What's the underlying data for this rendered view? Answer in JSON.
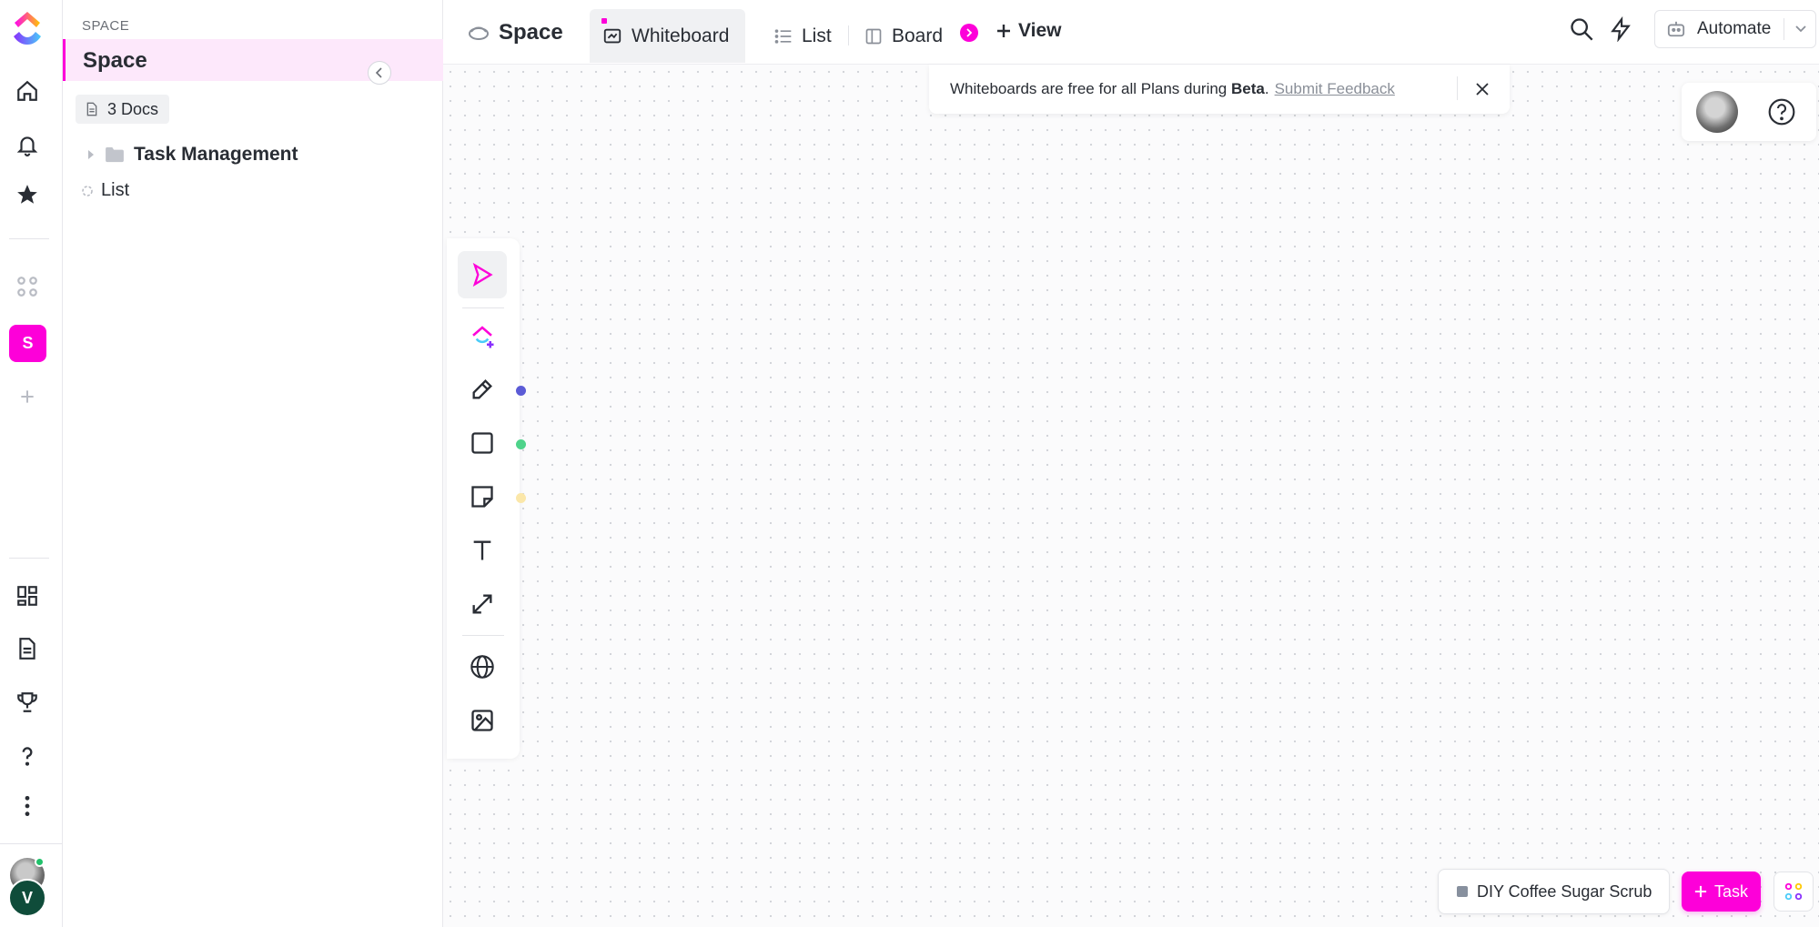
{
  "rail": {
    "space_letter": "S",
    "user_initial": "V",
    "icons": [
      "clickup-logo-icon",
      "home-icon",
      "bell-icon",
      "star-icon",
      "apps-grid-icon",
      "plus-icon",
      "dashboards-icon",
      "docs-icon",
      "trophy-icon",
      "help-icon",
      "more-vertical-icon"
    ]
  },
  "sidebar": {
    "header": "SPACE",
    "space_name": "Space",
    "docs_count": "3 Docs",
    "items": [
      {
        "label": "Task Management",
        "type": "folder"
      },
      {
        "label": "List",
        "type": "list"
      }
    ]
  },
  "topbar": {
    "space_name": "Space",
    "tabs": [
      {
        "label": "Whiteboard",
        "active": true
      },
      {
        "label": "List",
        "active": false
      },
      {
        "label": "Board",
        "active": false
      }
    ],
    "add_view": "View",
    "automate": "Automate"
  },
  "banner": {
    "text": "Whiteboards are free for all Plans during ",
    "bold": "Beta",
    "suffix": ".",
    "link": "Submit Feedback"
  },
  "palette": {
    "tools": [
      "select-tool",
      "ai-tool",
      "pen-tool",
      "shape-tool",
      "sticky-note-tool",
      "text-tool",
      "connector-tool",
      "embed-tool",
      "image-tool"
    ],
    "dot_colors": {
      "pen": "#5b5bd6",
      "shape": "#4ed38a",
      "sticky": "#fbe7a9"
    }
  },
  "bottom": {
    "task_name": "DIY Coffee Sugar Scrub",
    "task_button": "Task"
  },
  "colors": {
    "accent": "#fd00d9",
    "active_bg": "#fde8fb"
  }
}
